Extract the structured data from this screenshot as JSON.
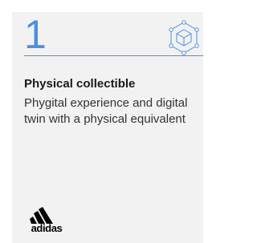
{
  "card": {
    "number": "1",
    "title": "Physical collectible",
    "description": "Phygital experience and digital twin with a physical equivalent",
    "icon": "cube-icon",
    "accent_color": "#4a90e2",
    "background_color": "#f2f2f2",
    "brand": {
      "logo_icon": "adidas-logo",
      "name": "adidas"
    }
  }
}
